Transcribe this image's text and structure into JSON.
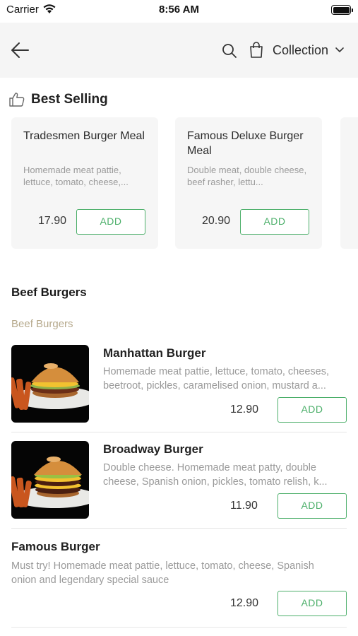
{
  "status": {
    "carrier": "Carrier",
    "time": "8:56 AM"
  },
  "nav": {
    "collection_label": "Collection"
  },
  "best_selling": {
    "title": "Best Selling",
    "cards": [
      {
        "name": "Tradesmen Burger Meal",
        "desc": "Homemade meat pattie, lettuce, tomato, cheese,...",
        "price": "17.90",
        "add": "ADD"
      },
      {
        "name": "Famous Deluxe Burger Meal",
        "desc": "Double meat, double cheese, beef rasher, lettu...",
        "price": "20.90",
        "add": "ADD"
      }
    ]
  },
  "section": {
    "title": "Beef Burgers",
    "subtitle": "Beef Burgers"
  },
  "items": [
    {
      "name": "Manhattan Burger",
      "desc1": "Homemade meat pattie, lettuce, tomato, cheeses,",
      "desc2": "beetroot, pickles, caramelised onion, mustard a...",
      "price": "12.90",
      "add": "ADD"
    },
    {
      "name": "Broadway Burger",
      "desc1": "Double cheese. Homemade meat patty, double",
      "desc2": "cheese, Spanish onion, pickles, tomato relish, k...",
      "price": "11.90",
      "add": "ADD"
    },
    {
      "name": "Famous Burger",
      "desc1": "Must try! Homemade meat pattie, lettuce, tomato, cheese, Spanish",
      "desc2": "onion and legendary special sauce",
      "price": "12.90",
      "add": "ADD"
    }
  ],
  "colors": {
    "accent_green": "#4caf6a",
    "subtitle_tan": "#b6a98c",
    "header_bg": "#f5f5f5"
  },
  "icons": [
    "wifi-icon",
    "battery-icon",
    "back-arrow-icon",
    "search-icon",
    "shopping-bag-icon",
    "chevron-down-icon",
    "thumbs-up-icon"
  ]
}
